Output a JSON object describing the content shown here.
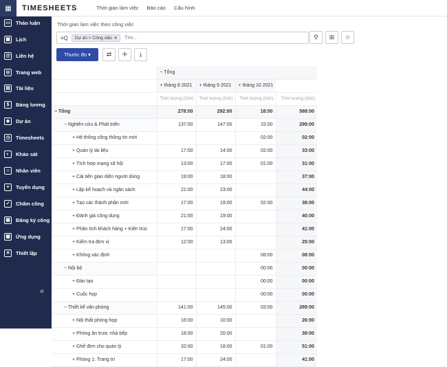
{
  "app": {
    "title": "TIMESHEETS",
    "menu": [
      "Thời gian làm việc",
      "Báo cáo",
      "Cấu hình"
    ]
  },
  "sidebar": {
    "items": [
      {
        "label": "Thảo luận",
        "icon": "chat-icon"
      },
      {
        "label": "Lịch",
        "icon": "calendar-icon"
      },
      {
        "label": "Liên hệ",
        "icon": "contact-icon"
      },
      {
        "label": "Trang web",
        "icon": "globe-icon"
      },
      {
        "label": "Tài liệu",
        "icon": "document-icon"
      },
      {
        "label": "Bảng lương",
        "icon": "payroll-icon"
      },
      {
        "label": "Dự án",
        "icon": "project-icon"
      },
      {
        "label": "Timesheets",
        "icon": "clock-icon"
      },
      {
        "label": "Khảo sát",
        "icon": "survey-icon"
      },
      {
        "label": "Nhân viên",
        "icon": "employees-icon"
      },
      {
        "label": "Tuyển dụng",
        "icon": "recruitment-icon"
      },
      {
        "label": "Chấm công",
        "icon": "attendance-icon"
      },
      {
        "label": "Đăng ký công",
        "icon": "time-register-icon"
      },
      {
        "label": "Ứng dụng",
        "icon": "apps-icon"
      },
      {
        "label": "Thiết lập",
        "icon": "settings-icon"
      }
    ],
    "collapse": "«"
  },
  "breadcrumb": "Thời gian làm việc theo công việc",
  "search": {
    "facet": "Dự án > Công việc",
    "placeholder": "Tìm..."
  },
  "toolbar": {
    "measure": "Thước đo ▾"
  },
  "pivot": {
    "total_header": "− Tổng",
    "months": [
      "+ tháng 8 2021",
      "+ tháng 9 2021",
      "+ tháng 10 2021"
    ],
    "measure_labels": [
      "Thời lượng (Giờ)",
      "Thời lượng (Giờ)",
      "Thời lượng (Giờ)",
      "Thời lượng (Giờ)"
    ],
    "rows": [
      {
        "label": "− Tổng",
        "level": 0,
        "vals": [
          "278:00",
          "292:00",
          "18:00",
          "588:00"
        ]
      },
      {
        "label": "− Nghiên cứu & Phát triển",
        "level": 1,
        "vals": [
          "137:00",
          "147:00",
          "15:00",
          "299:00"
        ]
      },
      {
        "label": "+ Hệ thống cổng thông tin mới",
        "level": 2,
        "vals": [
          "",
          "",
          "02:00",
          "02:00"
        ]
      },
      {
        "label": "+ Quản lý tài liệu",
        "level": 2,
        "vals": [
          "17:00",
          "14:00",
          "02:00",
          "33:00"
        ]
      },
      {
        "label": "+ Tích hợp mạng xã hội",
        "level": 2,
        "vals": [
          "13:00",
          "17:00",
          "01:00",
          "31:00"
        ]
      },
      {
        "label": "+ Cải tiến giao diện người dùng",
        "level": 2,
        "vals": [
          "19:00",
          "18:00",
          "",
          "37:00"
        ]
      },
      {
        "label": "+ Lập kế hoạch và ngân sách",
        "level": 2,
        "vals": [
          "21:00",
          "23:00",
          "",
          "44:00"
        ]
      },
      {
        "label": "+ Tạo các thành phần mới",
        "level": 2,
        "vals": [
          "17:00",
          "19:00",
          "02:00",
          "38:00"
        ]
      },
      {
        "label": "+ Đánh giá công dụng",
        "level": 2,
        "vals": [
          "21:00",
          "19:00",
          "",
          "40:00"
        ]
      },
      {
        "label": "+ Phân tích khách hàng + Kiến trúc",
        "level": 2,
        "vals": [
          "17:00",
          "24:00",
          "",
          "41:00"
        ]
      },
      {
        "label": "+ Kiểm tra đơn vị",
        "level": 2,
        "vals": [
          "12:00",
          "13:00",
          "",
          "25:00"
        ]
      },
      {
        "label": "+ Không xác định",
        "level": 2,
        "vals": [
          "",
          "",
          "08:00",
          "08:00"
        ]
      },
      {
        "label": "− Nội bộ",
        "level": 1,
        "vals": [
          "",
          "",
          "00:00",
          "00:00"
        ]
      },
      {
        "label": "+ Đào tạo",
        "level": 2,
        "vals": [
          "",
          "",
          "00:00",
          "00:00"
        ]
      },
      {
        "label": "+ Cuộc họp",
        "level": 2,
        "vals": [
          "",
          "",
          "00:00",
          "00:00"
        ]
      },
      {
        "label": "− Thiết kế văn phòng",
        "level": 1,
        "vals": [
          "141:00",
          "145:00",
          "03:00",
          "289:00"
        ]
      },
      {
        "label": "+ Nội thất phòng họp",
        "level": 2,
        "vals": [
          "16:00",
          "10:00",
          "",
          "26:00"
        ]
      },
      {
        "label": "+ Phòng ăn trưa: nhà bếp",
        "level": 2,
        "vals": [
          "18:00",
          "20:00",
          "",
          "38:00"
        ]
      },
      {
        "label": "+ Ghế đơn cho quản lý",
        "level": 2,
        "vals": [
          "32:00",
          "18:00",
          "01:00",
          "51:00"
        ]
      },
      {
        "label": "+ Phòng 1: Trang trí",
        "level": 2,
        "vals": [
          "17:00",
          "24:00",
          "",
          "41:00"
        ]
      }
    ]
  }
}
